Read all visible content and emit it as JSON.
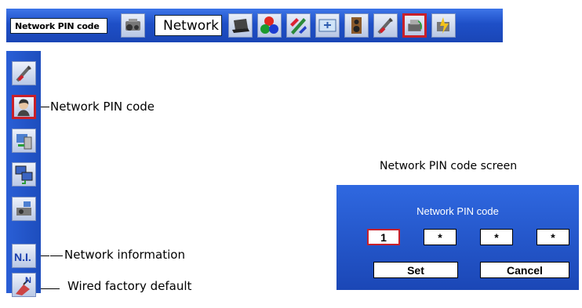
{
  "topbar": {
    "menu_label": "Network PIN code",
    "submenu_label": "Network",
    "icons": [
      "projector-icon",
      "laptop-icon",
      "color-balls-icon",
      "image-adjust-icon",
      "screen-icon",
      "speaker-icon",
      "tools-icon",
      "network-icon",
      "power-plug-icon"
    ],
    "selected_icon": "network-icon"
  },
  "sidebar": {
    "items": [
      {
        "icon": "tools-icon"
      },
      {
        "icon": "person-icon",
        "selected": true
      },
      {
        "icon": "network-settings-icon"
      },
      {
        "icon": "computer-network-icon"
      },
      {
        "icon": "projector-network-icon"
      },
      {
        "icon": "network-information-icon",
        "text": "N.I."
      },
      {
        "icon": "wired-factory-default-icon"
      }
    ]
  },
  "callouts": {
    "network_pin_code": "Network PIN code",
    "network_information": "Network information",
    "wired_factory_default": "Wired factory default"
  },
  "pin_screen": {
    "caption": "Network PIN code screen",
    "title": "Network PIN code",
    "digits": [
      "1",
      "*",
      "*",
      "*"
    ],
    "set_label": "Set",
    "cancel_label": "Cancel"
  },
  "colors": {
    "menu_blue": "#1e4fc7",
    "selection_red": "#c8202a"
  }
}
